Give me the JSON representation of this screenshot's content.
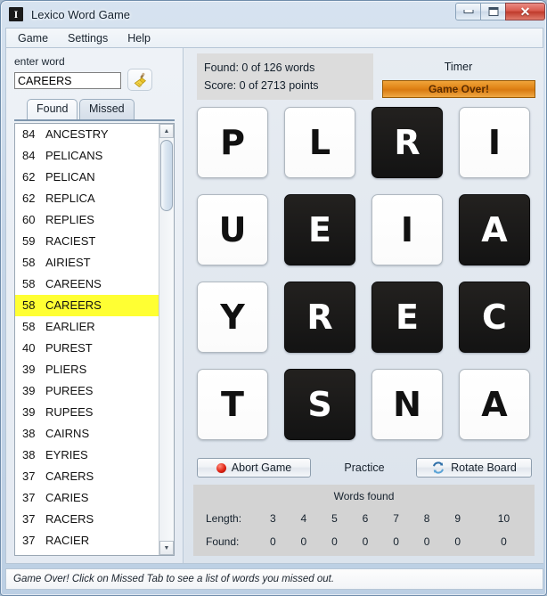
{
  "window": {
    "title": "Lexico Word Game",
    "icon": "app-icon",
    "buttons": {
      "minimize": "_",
      "maximize": "□",
      "close": "✕"
    }
  },
  "menu": {
    "items": [
      "Game",
      "Settings",
      "Help"
    ]
  },
  "left": {
    "enter_label": "enter word",
    "input_value": "CAREERS",
    "input_placeholder": "",
    "clear_icon": "broom-icon",
    "tabs": [
      {
        "label": "Found",
        "active": false
      },
      {
        "label": "Missed",
        "active": true
      }
    ],
    "list": [
      {
        "score": "84",
        "word": "ANCESTRY",
        "selected": false
      },
      {
        "score": "84",
        "word": "PELICANS",
        "selected": false
      },
      {
        "score": "62",
        "word": "PELICAN",
        "selected": false
      },
      {
        "score": "62",
        "word": "REPLICA",
        "selected": false
      },
      {
        "score": "60",
        "word": "REPLIES",
        "selected": false
      },
      {
        "score": "59",
        "word": "RACIEST",
        "selected": false
      },
      {
        "score": "58",
        "word": "AIRIEST",
        "selected": false
      },
      {
        "score": "58",
        "word": "CAREENS",
        "selected": false
      },
      {
        "score": "58",
        "word": "CAREERS",
        "selected": true
      },
      {
        "score": "58",
        "word": "EARLIER",
        "selected": false
      },
      {
        "score": "40",
        "word": "PUREST",
        "selected": false
      },
      {
        "score": "39",
        "word": "PLIERS",
        "selected": false
      },
      {
        "score": "39",
        "word": "PUREES",
        "selected": false
      },
      {
        "score": "39",
        "word": "RUPEES",
        "selected": false
      },
      {
        "score": "38",
        "word": "CAIRNS",
        "selected": false
      },
      {
        "score": "38",
        "word": "EYRIES",
        "selected": false
      },
      {
        "score": "37",
        "word": "CARERS",
        "selected": false
      },
      {
        "score": "37",
        "word": "CARIES",
        "selected": false
      },
      {
        "score": "37",
        "word": "RACERS",
        "selected": false
      },
      {
        "score": "37",
        "word": "RACIER",
        "selected": false
      }
    ]
  },
  "right": {
    "found_line": "Found: 0 of 126 words",
    "score_line": "Score: 0 of 2713 points",
    "timer_label": "Timer",
    "timer_value": "Game Over!",
    "timer_color": "#d97b12",
    "board": [
      {
        "letter": "P",
        "dark": false
      },
      {
        "letter": "L",
        "dark": false
      },
      {
        "letter": "R",
        "dark": true
      },
      {
        "letter": "I",
        "dark": false
      },
      {
        "letter": "U",
        "dark": false
      },
      {
        "letter": "E",
        "dark": true
      },
      {
        "letter": "I",
        "dark": false
      },
      {
        "letter": "A",
        "dark": true
      },
      {
        "letter": "Y",
        "dark": false
      },
      {
        "letter": "R",
        "dark": true
      },
      {
        "letter": "E",
        "dark": true
      },
      {
        "letter": "C",
        "dark": true
      },
      {
        "letter": "T",
        "dark": false
      },
      {
        "letter": "S",
        "dark": true
      },
      {
        "letter": "N",
        "dark": false
      },
      {
        "letter": "A",
        "dark": false
      }
    ],
    "abort_label": "Abort Game",
    "abort_icon": "red-dot-icon",
    "practice_label": "Practice",
    "rotate_label": "Rotate Board",
    "rotate_icon": "refresh-icon",
    "stats": {
      "title": "Words found",
      "length_label": "Length:",
      "found_label": "Found:",
      "lengths": [
        "3",
        "4",
        "5",
        "6",
        "7",
        "8",
        "9",
        "10"
      ],
      "counts": [
        "0",
        "0",
        "0",
        "0",
        "0",
        "0",
        "0",
        "0"
      ]
    }
  },
  "status": {
    "text": "Game Over! Click on Missed Tab to see a list of words you missed out."
  }
}
